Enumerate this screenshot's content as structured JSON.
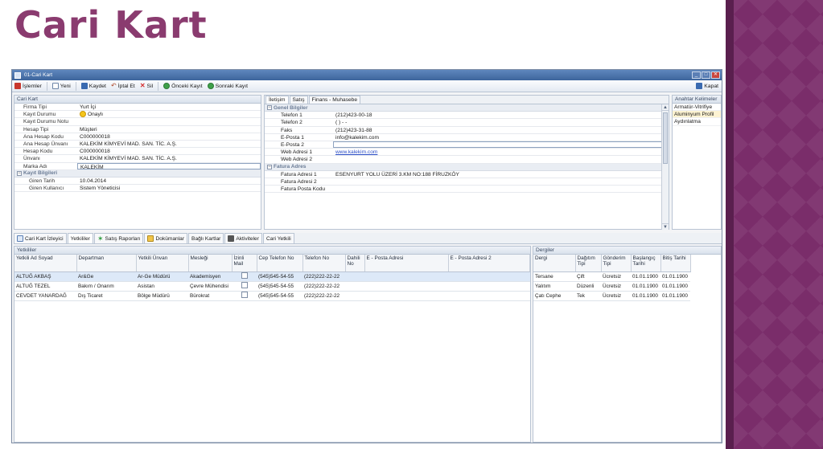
{
  "slide": {
    "title": "Cari Kart"
  },
  "window": {
    "title": "01-Cari Kart",
    "controls": [
      "_",
      "□",
      "✕"
    ]
  },
  "toolbar": {
    "islemler": "İşlemler",
    "yeni": "Yeni",
    "kaydet": "Kaydet",
    "iptal": "İptal Et",
    "sil": "Sil",
    "onceki": "Önceki Kayıt",
    "sonraki": "Sonraki Kayıt",
    "kapat": "Kapat"
  },
  "cari_kart": {
    "header": "Cari Kart",
    "fields": [
      {
        "label": "Firma Tipi",
        "value": "Yurt İçi"
      },
      {
        "label": "Kayıt Durumu",
        "value": "Onaylı"
      },
      {
        "label": "Kayıt Durumu Notu",
        "value": ""
      },
      {
        "label": "Hesap Tipi",
        "value": "Müşteri"
      },
      {
        "label": "Ana Hesap Kodu",
        "value": "C000000018"
      },
      {
        "label": "Ana Hesap Ünvanı",
        "value": "KALEKİM KİMYEVİ MAD. SAN. TİC. A.Ş."
      },
      {
        "label": "Hesap Kodu",
        "value": "C000000018"
      },
      {
        "label": "Ünvanı",
        "value": "KALEKİM KİMYEVİ MAD. SAN. TİC. A.Ş."
      },
      {
        "label": "Marka Adı",
        "value": "KALEKİM"
      }
    ],
    "group_kayit": "Kayıt Bilgileri",
    "kayit_fields": [
      {
        "label": "Giren Tarih",
        "value": "10.04.2014"
      },
      {
        "label": "Giren Kullanıcı",
        "value": "Sistem Yöneticisi"
      }
    ]
  },
  "mid_tabs": [
    "İletişim",
    "Satış",
    "Finans - Muhasebe"
  ],
  "iletisim": {
    "group_genel": "Genel Bilgiler",
    "genel": [
      {
        "label": "Telefon 1",
        "value": "(212)423-00-18"
      },
      {
        "label": "Telefon 2",
        "value": "(   )   -  -"
      },
      {
        "label": "Faks",
        "value": "(212)423-31-88"
      },
      {
        "label": "E-Posta 1",
        "value": "info@kalekim.com"
      },
      {
        "label": "E-Posta 2",
        "value": ""
      },
      {
        "label": "Web Adresi 1",
        "value": "www.kalekim.com"
      },
      {
        "label": "Web Adresi 2",
        "value": ""
      }
    ],
    "group_fatura": "Fatura Adres",
    "fatura": [
      {
        "label": "Fatura Adresi 1",
        "value": "ESENYURT YOLU ÜZERİ 3.KM NO:188 FİRUZKÖY"
      },
      {
        "label": "Fatura Adresi 2",
        "value": ""
      },
      {
        "label": "Fatura Posta Kodu",
        "value": ""
      }
    ]
  },
  "anahtar": {
    "header": "Anahtar Kelimeler",
    "items": [
      "Armatür-Vitrifiye",
      "Aluminyum Profil",
      "Aydınlatma"
    ]
  },
  "bottom_tabs": [
    "Cari Kart İzleyici",
    "Yetkililer",
    "Satış Raporları",
    "Dokümanlar",
    "Bağlı Kartlar",
    "Aktiviteler",
    "Cari Yetkili"
  ],
  "yetkililer": {
    "header": "Yetkililer",
    "columns": [
      "Yetkili Ad Soyad",
      "Departman",
      "Yetkili Ünvan",
      "Mesleği",
      "İzinli Mail",
      "Cep Telefon No",
      "Telefon No",
      "Dahili No",
      "E - Posta Adresi",
      "E - Posta Adresi 2"
    ],
    "rows": [
      {
        "ad": "ALTUĞ AKBAŞ",
        "dep": "Ar&Ge",
        "unvan": "Ar-Ge Müdürü",
        "meslek": "Akademisyen",
        "izin": "",
        "cep": "(545)545-54-55",
        "tel": "(222)222-22-22",
        "dahili": "",
        "eposta": "",
        "eposta2": ""
      },
      {
        "ad": "ALTUĞ TEZEL",
        "dep": "Bakım / Onarım",
        "unvan": "Asistan",
        "meslek": "Çevre Mühendisi",
        "izin": "",
        "cep": "(545)545-54-55",
        "tel": "(222)222-22-22",
        "dahili": "",
        "eposta": "",
        "eposta2": ""
      },
      {
        "ad": "CEVDET YANARDAĞ",
        "dep": "Dış Ticaret",
        "unvan": "Bölge Müdürü",
        "meslek": "Bürokrat",
        "izin": "",
        "cep": "(545)545-54-55",
        "tel": "(222)222-22-22",
        "dahili": "",
        "eposta": "",
        "eposta2": ""
      }
    ]
  },
  "dergiler": {
    "header": "Dergiler",
    "columns": [
      "Dergi",
      "Dağıtım Tipi",
      "Gönderim Tipi",
      "Başlangıç Tarihi",
      "Bitiş Tarihi"
    ],
    "rows": [
      {
        "dergi": "Tersane",
        "dagitim": "Çift",
        "gonderim": "Ücretsiz",
        "bas": "01.01.1900",
        "bit": "01.01.1900"
      },
      {
        "dergi": "Yalıtım",
        "dagitim": "Düzenli",
        "gonderim": "Ücretsiz",
        "bas": "01.01.1900",
        "bit": "01.01.1900"
      },
      {
        "dergi": "Çatı Cephe",
        "dagitim": "Tek",
        "gonderim": "Ücretsiz",
        "bas": "01.01.1900",
        "bit": "01.01.1900"
      }
    ]
  },
  "colors": {
    "title": "#8a3b6f",
    "deco": "#7a2d6a",
    "titlebar": "#4a72aa",
    "link": "#2d4fc7"
  }
}
